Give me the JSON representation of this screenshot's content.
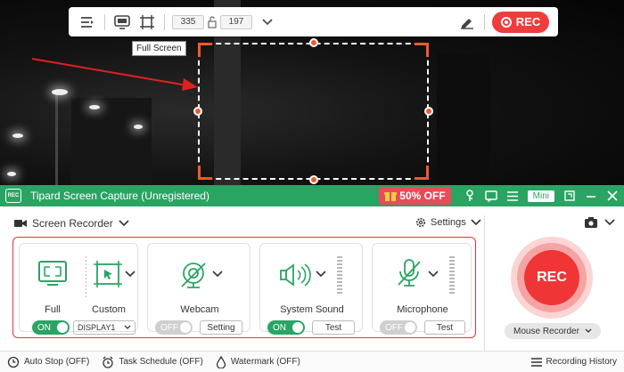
{
  "toolbar": {
    "width_value": "335",
    "height_value": "197",
    "rec_label": "REC"
  },
  "tooltip": {
    "text": "Full Screen"
  },
  "app": {
    "title": "Tipard Screen Capture (Unregistered)",
    "logo_text": "REC",
    "promo": "50% OFF",
    "mini_label": "Mini"
  },
  "recorder": {
    "mode_label": "Screen Recorder",
    "settings_label": "Settings"
  },
  "display": {
    "full_label": "Full",
    "custom_label": "Custom",
    "toggle": "ON",
    "select_value": "DISPLAY1"
  },
  "webcam": {
    "label": "Webcam",
    "toggle": "OFF",
    "button": "Setting"
  },
  "system_sound": {
    "label": "System Sound",
    "toggle": "ON",
    "button": "Test"
  },
  "microphone": {
    "label": "Microphone",
    "toggle": "OFF",
    "button": "Test"
  },
  "rec_button": {
    "label": "REC"
  },
  "mouse_recorder": {
    "label": "Mouse Recorder"
  },
  "statusbar": {
    "auto_stop": "Auto Stop (OFF)",
    "task_schedule": "Task Schedule (OFF)",
    "watermark": "Watermark (OFF)",
    "history": "Recording History"
  },
  "colors": {
    "brand_green": "#2aa463",
    "rec_red": "#ef3c3c",
    "selection_orange": "#f05a28"
  }
}
